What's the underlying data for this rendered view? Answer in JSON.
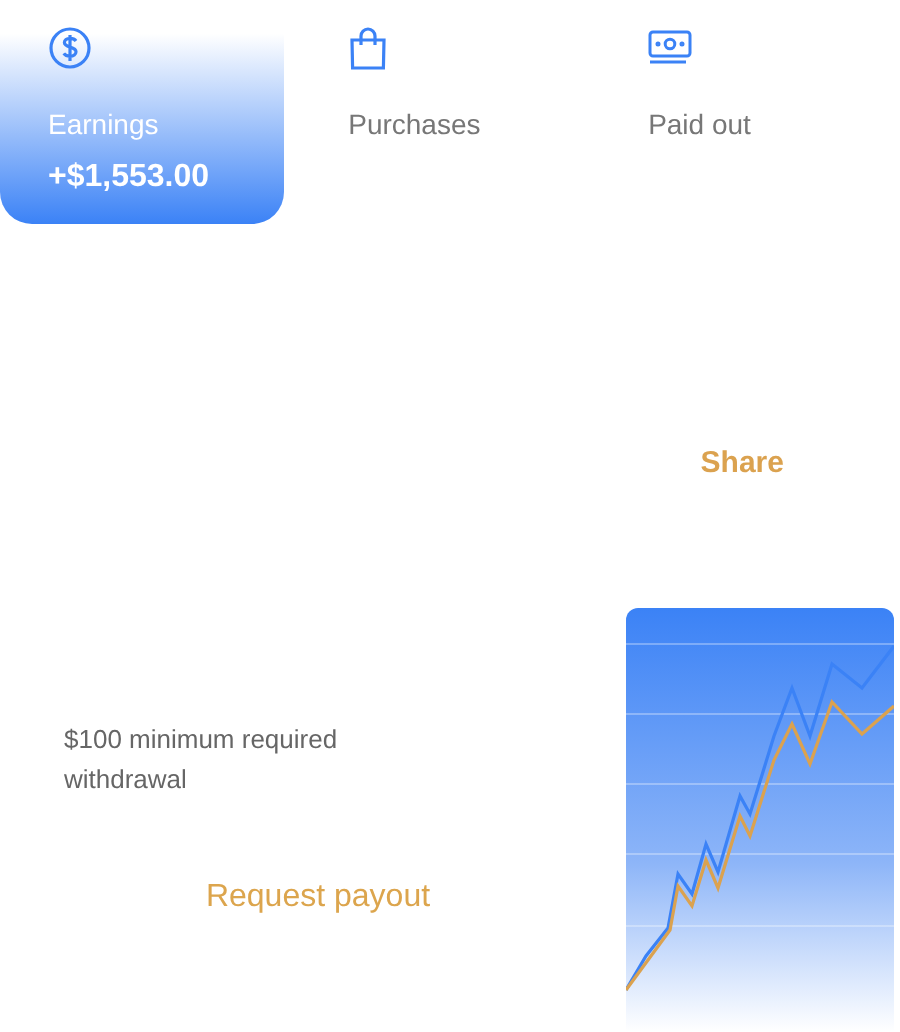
{
  "tabs": [
    {
      "kind": "dollar",
      "label": "Earnings",
      "amount": "+$1,553.00",
      "selected": true
    },
    {
      "kind": "bag",
      "label": "Purchases",
      "selected": false
    },
    {
      "kind": "cash",
      "label": "Paid out",
      "selected": false
    }
  ],
  "share": {
    "label": "Share"
  },
  "payout": {
    "note": "$100 minimum required withdrawal",
    "button": "Request payout"
  }
}
